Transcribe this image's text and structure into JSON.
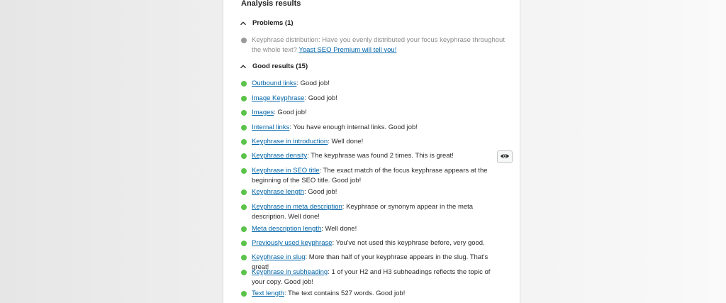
{
  "panel": {
    "title": "Analysis results"
  },
  "problems": {
    "header": "Problems (1)",
    "items": [
      {
        "prefix": "Keyphrase distribution: Have you evenly distributed your focus keyphrase throughout the whole text? ",
        "link": "Yoast SEO Premium will tell you!",
        "status": "grey"
      }
    ]
  },
  "good": {
    "header": "Good results (15)",
    "items": [
      {
        "link": "Outbound links",
        "text": ": Good job!"
      },
      {
        "link": "Image Keyphrase",
        "text": ": Good job!"
      },
      {
        "link": "Images",
        "text": ": Good job!"
      },
      {
        "link": "Internal links",
        "text": ": You have enough internal links. Good job!"
      },
      {
        "link": "Keyphrase in introduction",
        "text": ": Well done!"
      },
      {
        "link": "Keyphrase density",
        "text": ": The keyphrase was found 2 times. This is great!"
      },
      {
        "link": "Keyphrase in SEO title",
        "text": ": The exact match of the focus keyphrase appears at the beginning of the SEO title. Good job!"
      },
      {
        "link": "Keyphrase length",
        "text": ": Good job!"
      },
      {
        "link": "Keyphrase in meta description",
        "text": ": Keyphrase or synonym appear in the meta description. Well done!"
      },
      {
        "link": "Meta description length",
        "text": ": Well done!"
      },
      {
        "link": "Previously used keyphrase",
        "text": ": You've not used this keyphrase before, very good."
      },
      {
        "link": "Keyphrase in slug",
        "text": ": More than half of your keyphrase appears in the slug. That's great!"
      },
      {
        "link": "Keyphrase in subheading",
        "text": ": 1 of your H2 and H3 subheadings reflects the topic of your copy. Good job!"
      },
      {
        "link": "Text length",
        "text": ": The text contains 527 words. Good job!"
      }
    ]
  },
  "colors": {
    "good": "#5bc34a",
    "problem": "#9a9a9a",
    "link": "#0064a8"
  },
  "icons": {
    "collapse": "chevron-up-icon",
    "highlight": "eye-icon"
  }
}
